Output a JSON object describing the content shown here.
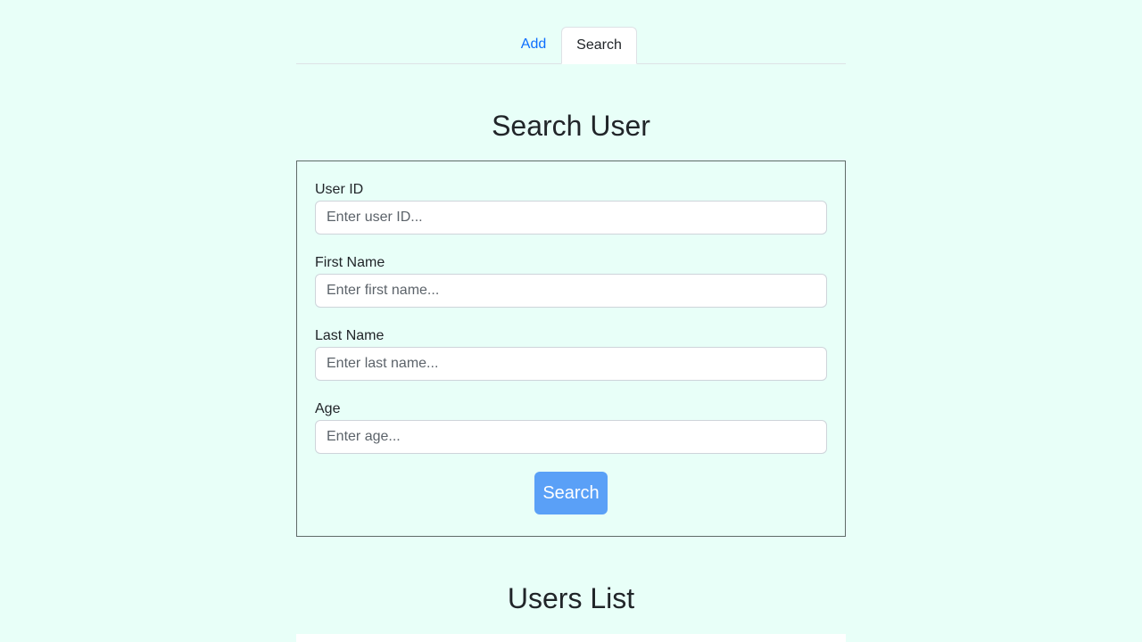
{
  "tabs": [
    {
      "label": "Add",
      "active": false
    },
    {
      "label": "Search",
      "active": true
    }
  ],
  "search_form": {
    "title": "Search User",
    "fields": [
      {
        "label": "User ID",
        "placeholder": "Enter user ID...",
        "value": ""
      },
      {
        "label": "First Name",
        "placeholder": "Enter first name...",
        "value": ""
      },
      {
        "label": "Last Name",
        "placeholder": "Enter last name...",
        "value": ""
      },
      {
        "label": "Age",
        "placeholder": "Enter age...",
        "value": ""
      }
    ],
    "submit_label": "Search"
  },
  "users_list": {
    "title": "Users List"
  },
  "colors": {
    "background": "#e8fff8",
    "link": "#0d6efd",
    "button": "#5aa0f7",
    "text": "#212529"
  }
}
